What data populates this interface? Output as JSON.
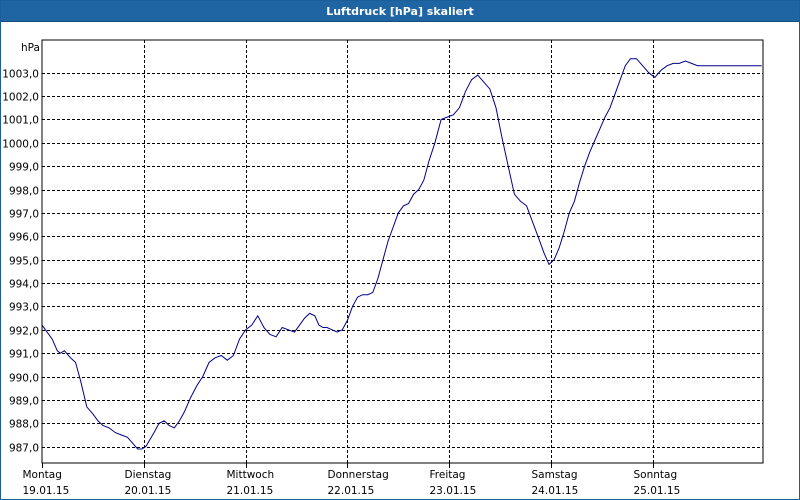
{
  "window": {
    "title": "Luftdruck [hPa] skaliert"
  },
  "colors": {
    "titlebar": "#1f64a3",
    "line": "#00008b",
    "grid": "#000000"
  },
  "chart_data": {
    "type": "line",
    "title": "Luftdruck [hPa] skaliert",
    "ylabel": "hPa",
    "xlabel": "",
    "grid": true,
    "ylim": [
      986.3,
      1004.4
    ],
    "xlim": [
      0,
      7.07
    ],
    "yticks": [
      "987,0",
      "988,0",
      "989,0",
      "990,0",
      "991,0",
      "992,0",
      "993,0",
      "994,0",
      "995,0",
      "996,0",
      "997,0",
      "998,0",
      "999,0",
      "1000,0",
      "1001,0",
      "1002,0",
      "1003,0"
    ],
    "xticks": [
      {
        "day": "Montag",
        "date": "19.01.15"
      },
      {
        "day": "Dienstag",
        "date": "20.01.15"
      },
      {
        "day": "Mittwoch",
        "date": "21.01.15"
      },
      {
        "day": "Donnerstag",
        "date": "22.01.15"
      },
      {
        "day": "Freitag",
        "date": "23.01.15"
      },
      {
        "day": "Samstag",
        "date": "24.01.15"
      },
      {
        "day": "Sonntag",
        "date": "25.01.15"
      }
    ],
    "series": [
      {
        "x": [
          0.0,
          0.05,
          0.1,
          0.15,
          0.18,
          0.22,
          0.28,
          0.33,
          0.38,
          0.44,
          0.5,
          0.55,
          0.6,
          0.66,
          0.72,
          0.78,
          0.84,
          0.9,
          0.94,
          0.98,
          1.02,
          1.06,
          1.1,
          1.15,
          1.2,
          1.25,
          1.3,
          1.35,
          1.4,
          1.46,
          1.52,
          1.58,
          1.64,
          1.7,
          1.76,
          1.82,
          1.88,
          1.94,
          2.0,
          2.06,
          2.12,
          2.18,
          2.24,
          2.3,
          2.36,
          2.42,
          2.48,
          2.53,
          2.58,
          2.63,
          2.68,
          2.72,
          2.76,
          2.8,
          2.85,
          2.9,
          2.95,
          3.0,
          3.05,
          3.1,
          3.15,
          3.2,
          3.25,
          3.3,
          3.35,
          3.4,
          3.45,
          3.5,
          3.55,
          3.6,
          3.65,
          3.7,
          3.75,
          3.8,
          3.86,
          3.92,
          3.98,
          4.04,
          4.1,
          4.16,
          4.22,
          4.28,
          4.34,
          4.4,
          4.46,
          4.52,
          4.58,
          4.64,
          4.7,
          4.76,
          4.82,
          4.88,
          4.93,
          4.98,
          5.03,
          5.08,
          5.13,
          5.18,
          5.23,
          5.28,
          5.33,
          5.38,
          5.43,
          5.48,
          5.53,
          5.58,
          5.63,
          5.68,
          5.73,
          5.78,
          5.84,
          5.9,
          5.96,
          6.02,
          6.08,
          6.14,
          6.2,
          6.26,
          6.32,
          6.38,
          6.44,
          6.5,
          6.56,
          6.62,
          6.68,
          6.74,
          6.8,
          6.86,
          6.92,
          6.98,
          7.03,
          7.07
        ],
        "values": [
          992.2,
          991.9,
          991.6,
          991.1,
          991.0,
          991.1,
          990.8,
          990.6,
          989.8,
          988.7,
          988.4,
          988.1,
          987.9,
          987.8,
          987.6,
          987.5,
          987.4,
          987.1,
          986.9,
          986.9,
          987.0,
          987.3,
          987.6,
          988.0,
          988.1,
          987.9,
          987.8,
          988.1,
          988.5,
          989.1,
          989.6,
          990.0,
          990.6,
          990.8,
          990.9,
          990.7,
          990.9,
          991.6,
          992.0,
          992.2,
          992.6,
          992.1,
          991.8,
          991.7,
          992.1,
          992.0,
          991.9,
          992.2,
          992.5,
          992.7,
          992.6,
          992.2,
          992.1,
          992.1,
          992.0,
          991.9,
          992.0,
          992.4,
          993.0,
          993.4,
          993.5,
          993.5,
          993.6,
          994.2,
          995.0,
          995.8,
          996.4,
          997.0,
          997.3,
          997.4,
          997.8,
          998.0,
          998.4,
          999.2,
          1000.0,
          1001.0,
          1001.1,
          1001.2,
          1001.5,
          1002.2,
          1002.7,
          1002.9,
          1002.6,
          1002.3,
          1001.5,
          1000.2,
          999.0,
          997.8,
          997.5,
          997.3,
          996.6,
          995.9,
          995.3,
          994.8,
          995.0,
          995.5,
          996.2,
          997.0,
          997.5,
          998.3,
          999.0,
          999.6,
          1000.1,
          1000.6,
          1001.1,
          1001.5,
          1002.1,
          1002.7,
          1003.3,
          1003.6,
          1003.6,
          1003.3,
          1003.0,
          1002.8,
          1003.1,
          1003.3,
          1003.4,
          1003.4,
          1003.5,
          1003.4,
          1003.3,
          1003.3,
          1003.3,
          1003.3,
          1003.3,
          1003.3,
          1003.3,
          1003.3,
          1003.3,
          1003.3,
          1003.3,
          1003.3
        ]
      }
    ]
  }
}
